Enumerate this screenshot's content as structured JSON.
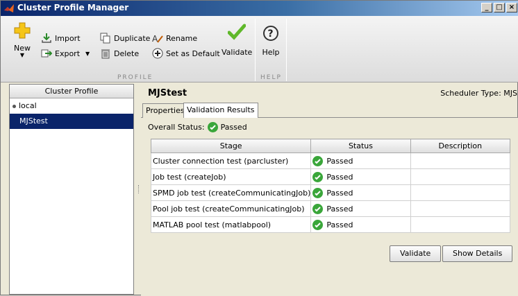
{
  "window": {
    "title": "Cluster Profile Manager",
    "minimize": "_",
    "maximize": "□",
    "close": "×"
  },
  "toolstrip": {
    "new_label": "New",
    "import_label": "Import",
    "export_label": "Export",
    "duplicate_label": "Duplicate",
    "delete_label": "Delete",
    "rename_label": "Rename",
    "set_default_label": "Set as Default",
    "validate_label": "Validate",
    "help_label": "Help",
    "group_profile": "PROFILE",
    "group_help": "HELP"
  },
  "profiles": {
    "header": "Cluster Profile",
    "items": [
      {
        "label": "local"
      },
      {
        "label": "MJStest"
      }
    ]
  },
  "main": {
    "profile_name": "MJStest",
    "scheduler_type": "Scheduler Type: MJS",
    "tabs": [
      {
        "label": "Properties"
      },
      {
        "label": "Validation Results"
      }
    ],
    "overall_label": "Overall Status:",
    "overall_value": "Passed",
    "columns": [
      "Stage",
      "Status",
      "Description"
    ],
    "rows": [
      {
        "stage": "Cluster connection test (parcluster)",
        "status": "Passed",
        "description": ""
      },
      {
        "stage": "Job test (createJob)",
        "status": "Passed",
        "description": ""
      },
      {
        "stage": "SPMD job test (createCommunicatingJob)",
        "status": "Passed",
        "description": ""
      },
      {
        "stage": "Pool job test (createCommunicatingJob)",
        "status": "Passed",
        "description": ""
      },
      {
        "stage": "MATLAB pool test (matlabpool)",
        "status": "Passed",
        "description": ""
      }
    ],
    "validate_button": "Validate",
    "show_details_button": "Show Details"
  },
  "colors": {
    "title_bar": "#0a246a",
    "selection": "#0a246a",
    "passed": "#3aa63a"
  }
}
